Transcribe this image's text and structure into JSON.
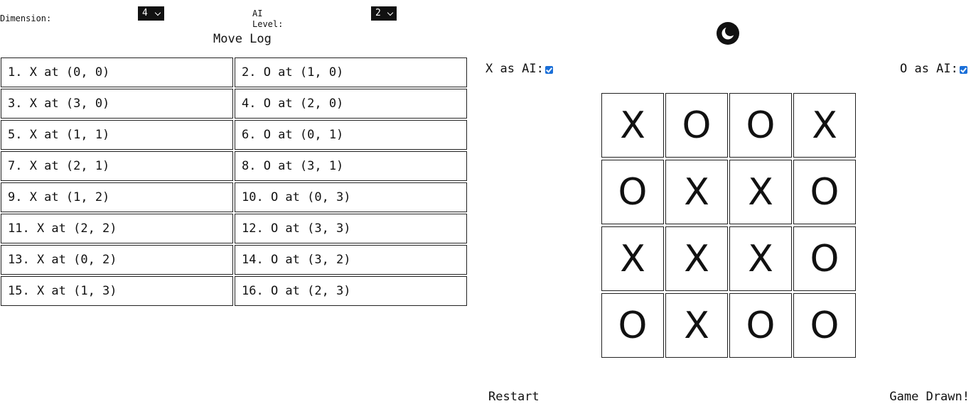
{
  "controls": {
    "dimension_label": "Dimension:",
    "dimension_value": "4",
    "ai_level_label": "AI Level:",
    "ai_level_value": "2",
    "theme_icon": "moon-icon"
  },
  "move_log": {
    "title": "Move Log",
    "moves": [
      "1. X at (0, 0)",
      "2. O at (1, 0)",
      "3. X at (3, 0)",
      "4. O at (2, 0)",
      "5. X at (1, 1)",
      "6. O at (0, 1)",
      "7. X at (2, 1)",
      "8. O at (3, 1)",
      "9. X at (1, 2)",
      "10. O at (0, 3)",
      "11. X at (2, 2)",
      "12. O at (3, 3)",
      "13. X at (0, 2)",
      "14. O at (3, 2)",
      "15. X at (1, 3)",
      "16. O at (2, 3)"
    ]
  },
  "players": {
    "x_ai_label": "X as AI:",
    "x_ai_checked": true,
    "o_ai_label": "O as AI:",
    "o_ai_checked": true
  },
  "board": {
    "size": 4,
    "rows": [
      [
        "X",
        "O",
        "O",
        "X"
      ],
      [
        "O",
        "X",
        "X",
        "O"
      ],
      [
        "X",
        "X",
        "X",
        "O"
      ],
      [
        "O",
        "X",
        "O",
        "O"
      ]
    ]
  },
  "footer": {
    "restart_label": "Restart",
    "status": "Game Drawn!"
  },
  "colors": {
    "checkbox_accent": "#1a6fd8",
    "select_bg": "#111111"
  }
}
